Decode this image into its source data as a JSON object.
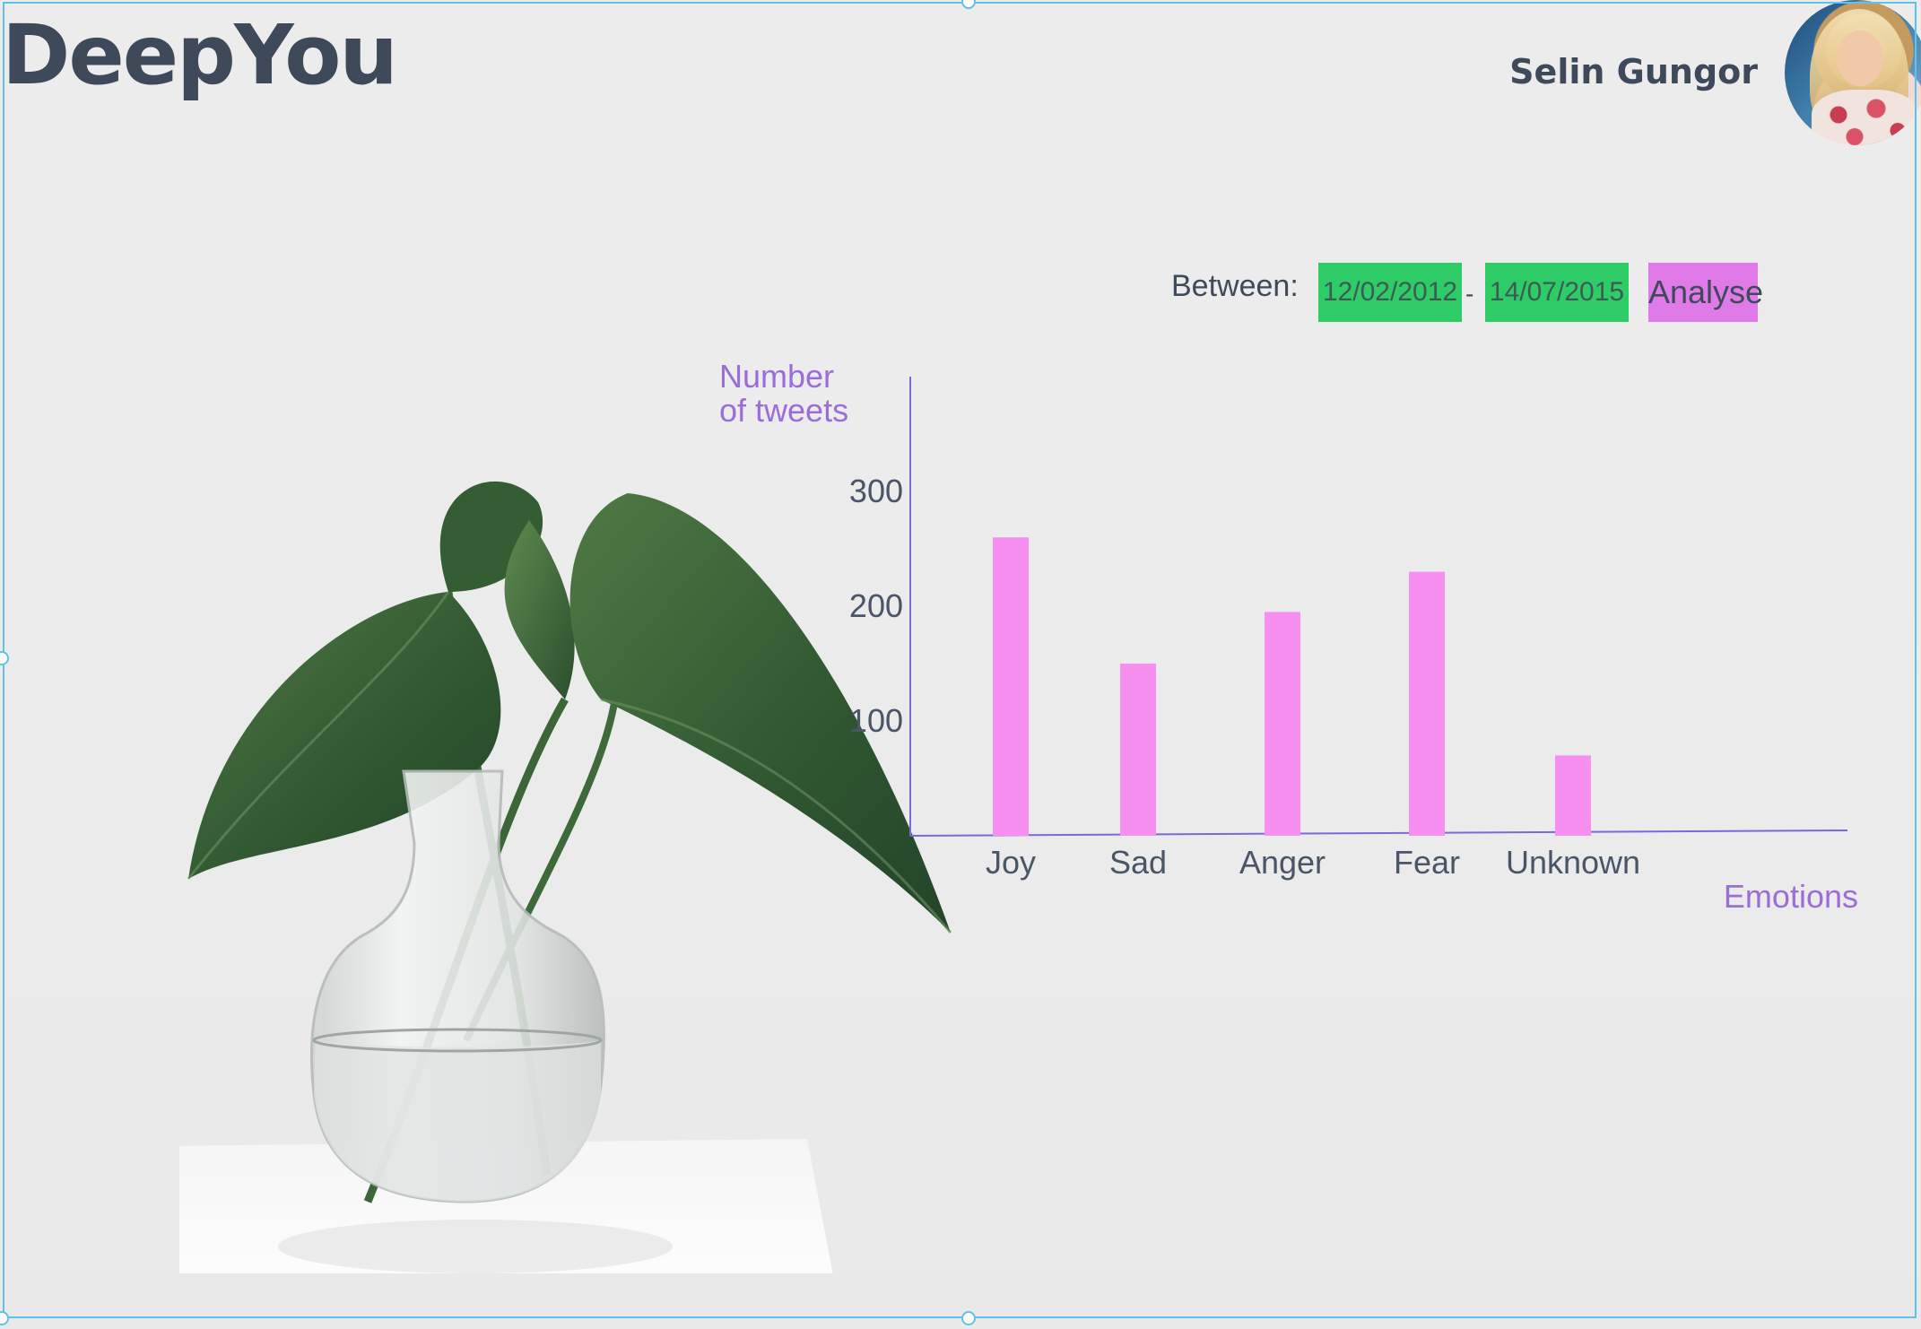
{
  "app": {
    "title": "DeepYou"
  },
  "user": {
    "name": "Selin Gungor"
  },
  "filter": {
    "between_label": "Between:",
    "start_date": "12/02/2012",
    "separator": "-",
    "end_date": "14/07/2015",
    "analyse_label": "Analyse"
  },
  "colors": {
    "bar": "#f78ff0",
    "axis": "#7b68d9",
    "axis_title": "#9a6ddb",
    "date_bg": "#2ecc66",
    "button_bg": "#e07ae8"
  },
  "chart_data": {
    "type": "bar",
    "categories": [
      "Joy",
      "Sad",
      "Anger",
      "Fear",
      "Unknown"
    ],
    "values": [
      260,
      150,
      195,
      230,
      70
    ],
    "yticks": [
      100,
      200,
      300
    ],
    "ylim": [
      0,
      400
    ],
    "ylabel_lines": [
      "Number",
      "of tweets"
    ],
    "xlabel": "Emotions",
    "grid": false,
    "legend": "none"
  }
}
